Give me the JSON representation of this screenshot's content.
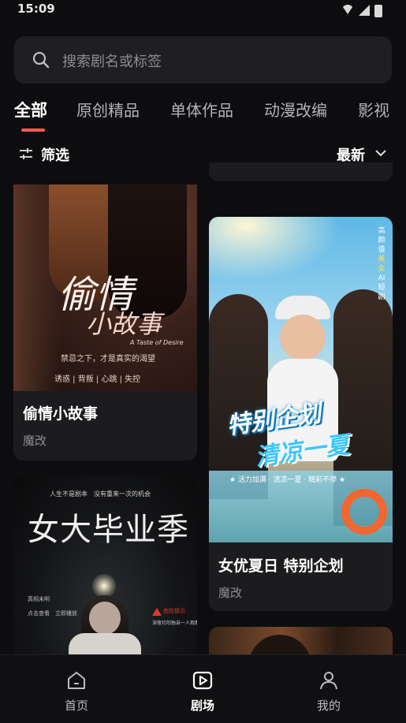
{
  "status_bar": {
    "time": "15:09"
  },
  "search": {
    "placeholder": "搜索剧名或标签"
  },
  "tabs": [
    {
      "label": "全部",
      "active": true
    },
    {
      "label": "原创精品",
      "active": false
    },
    {
      "label": "单体作品",
      "active": false
    },
    {
      "label": "动漫改编",
      "active": false
    },
    {
      "label": "影视",
      "active": false
    }
  ],
  "filter": {
    "label": "筛选"
  },
  "sort": {
    "label": "最新"
  },
  "cards": [
    {
      "title": "偷情小故事",
      "tag": "魔改",
      "poster": {
        "main_title": "偷情",
        "sub_title": "小故事",
        "script_line": "A Taste of Desire",
        "tagline": "禁忌之下，才是真实的渴望",
        "keywords": "诱惑 | 背叛 | 心跳 | 失控"
      }
    },
    {
      "title": "女优夏日 特别企划",
      "tag": "魔改",
      "poster": {
        "side_tags": [
          "高颜值",
          "美女",
          "AI",
          "短剧"
        ],
        "headline_1": "特别企划",
        "headline_2": "清凉一夏",
        "slogan": "★ 活力加满 · 清凉一夏 · 精彩不停 ★"
      }
    },
    {
      "poster": {
        "main_title": "女大毕业季",
        "tagline": "人生不是剧本　没有重来一次的机会",
        "left_note_1": "真相未明",
        "left_note_2": "点击查看　立即播放",
        "warning_tag": "危险提示",
        "warning_text": "深夜切勿独自一人观看"
      }
    }
  ],
  "bottom_nav": [
    {
      "label": "首页",
      "icon": "home-icon",
      "active": false
    },
    {
      "label": "剧场",
      "icon": "theater-play-icon",
      "active": true
    },
    {
      "label": "我的",
      "icon": "profile-icon",
      "active": false
    }
  ],
  "colors": {
    "accent": "#ff5a4a",
    "background": "#0d0d0f",
    "card": "#1c1c1f"
  }
}
